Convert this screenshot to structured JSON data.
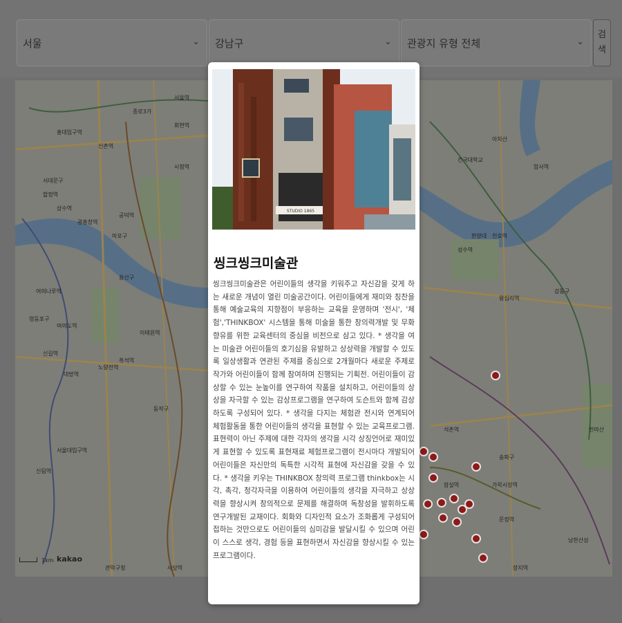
{
  "filters": {
    "city": "서울",
    "district": "강남구",
    "type": "관광지 유형 전체",
    "chevron": "⌄",
    "search_line1": "검",
    "search_line2": "색"
  },
  "map": {
    "brand": "kakao",
    "scale": "1km",
    "labels": [
      "홍대입구역",
      "신촌역",
      "서대문구",
      "서울역",
      "회현역",
      "시청역",
      "종로3가",
      "합정역",
      "상수역",
      "광흥창역",
      "공덕역",
      "마포구",
      "용산구",
      "이태원역",
      "여의나루역",
      "여의도역",
      "신길역",
      "대방역",
      "노량진역",
      "흑석역",
      "영등포구",
      "신림역",
      "동작구",
      "서울대입구역",
      "관악구청",
      "사당역",
      "천호역",
      "잠실역",
      "송파구",
      "강동구",
      "암사역",
      "한양대",
      "아차산",
      "성수역",
      "왕십리역",
      "건국대학교",
      "석촌역",
      "가락시장역",
      "문정역",
      "장지역",
      "천마산",
      "남한산성"
    ]
  },
  "modal": {
    "title": "씽크씽크미술관",
    "description": "씽크씽크미술관은 어린이들의 생각을 키워주고 자신감을 갖게 하는 새로운 개념이 열린 미술공간이다. 어린이들에게 재미와 칭찬을 통해 예술교육의 지향점이 부응하는 교육을 운영하며 '전시', '체험','THINKBOX' 시스템을 통해 미술을 통한 창의력개발 및 무화향유를 위한 교육센터의 중심을 비전으로 삼고 있다. * 생각을 여는 미술관 어린이들의 호기심을 유발하고 상상력을 개발할 수 있도록 일상생활과 연관된 주제를 중심으로 2개월마다 새로운 주제로 작가와 어린이들이 함께 참여하며 진행되는 기획전. 어린이들이 감상할 수 있는 눈높이를 연구하여 작품을 설치하고, 어린이들의 상상을 자극할 수 있는 감상프로그램을 연구하여 도슨트와 함께 감상하도록 구성되어 있다. * 생각을 다지는 체험관 전시와 연계되어 체험활동을 통한 어린이들의 생각을 표현할 수 있는 교육프로그램. 표현력이 아닌 주제에 대한 각자의 생각을 시각 상징언어로 재미있게 표현할 수 있도록 표현재료 체험프로그램이 전시마다 개발되어 어린이들은 자신만의 독특한 시각적 표현에 자신감을 갖을 수 있다. * 생각을 키우는 THINKBOX 창의력 프로그램 thinkbox는 시각, 촉각, 청각자극을 이용하여 어린이들의 생각을 자극하고 상상력을 향상시켜 창의적으로 문제를 해결하며 독창성을 발휘하도록 연구개발된 교재이다. 회화와 디자인적 요소가 조화롭게 구성되어 접하는 것만으로도 어린이들의 심미감을 발달시킬 수 있으며 어린이 스스로 생각, 경험 등을 표현하면서 자신감을 향상시킬 수 있는 프로그램이다.",
    "sign_text": "STUDIO 1865"
  },
  "colors": {
    "overlay": "#6f6f6f",
    "marker": "#8b1a1a",
    "river": "#557a9a",
    "modal_bg": "#ffffff"
  }
}
